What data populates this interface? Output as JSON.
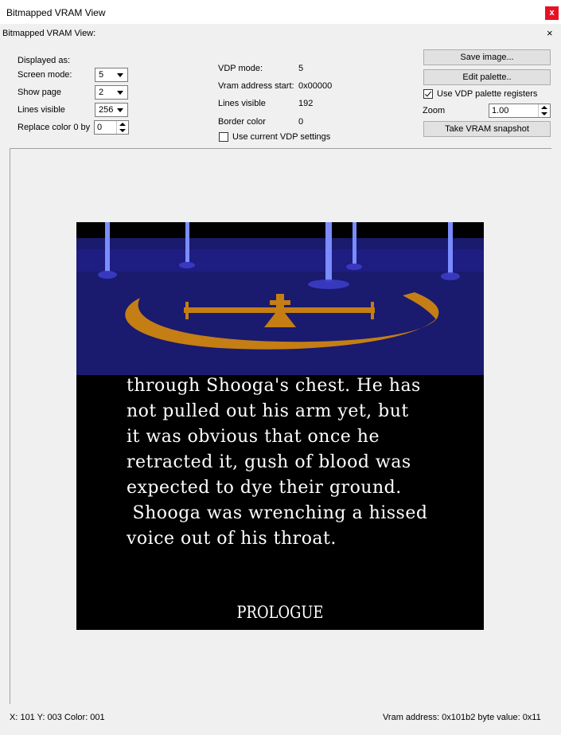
{
  "window": {
    "title": "Bitmapped VRAM View",
    "close_label": "x"
  },
  "panel": {
    "title": "Bitmapped VRAM View:",
    "close_label": "×"
  },
  "left": {
    "displayed_as": "Displayed as:",
    "screen_mode_label": "Screen mode:",
    "screen_mode_value": "5",
    "show_page_label": "Show page",
    "show_page_value": "2",
    "lines_visible_label": "Lines visible",
    "lines_visible_value": "256",
    "replace_color_label": "Replace color 0 by",
    "replace_color_value": "0"
  },
  "middle": {
    "vdp_mode_label": "VDP mode:",
    "vdp_mode_value": "5",
    "vram_start_label": "Vram address start:",
    "vram_start_value": "0x00000",
    "lines_visible_label": "Lines visible",
    "lines_visible_value": "192",
    "border_color_label": "Border color",
    "border_color_value": "0",
    "use_current_vdp_label": "Use current VDP settings"
  },
  "right": {
    "save_image": "Save image...",
    "edit_palette": "Edit palette..",
    "use_vdp_palette_label": "Use VDP  palette registers",
    "zoom_label": "Zoom",
    "zoom_value": "1.00",
    "take_snapshot": "Take VRAM snapshot"
  },
  "image": {
    "story_lines": [
      "through Shooga's chest. He has",
      "not pulled out his arm yet, but",
      "it was obvious that once he",
      "retracted it, gush of blood was",
      "expected to dye their ground.",
      " Shooga was wrenching a hissed",
      "voice out of his throat."
    ],
    "caption": "PROLOGUE",
    "colors": {
      "sky": "#1a1a6e",
      "gold": "#c47e14",
      "pillar": "#7a8cff"
    }
  },
  "status": {
    "coords": "X: 101  Y: 003  Color: 001",
    "vram": "Vram address: 0x101b2  byte value: 0x11"
  }
}
